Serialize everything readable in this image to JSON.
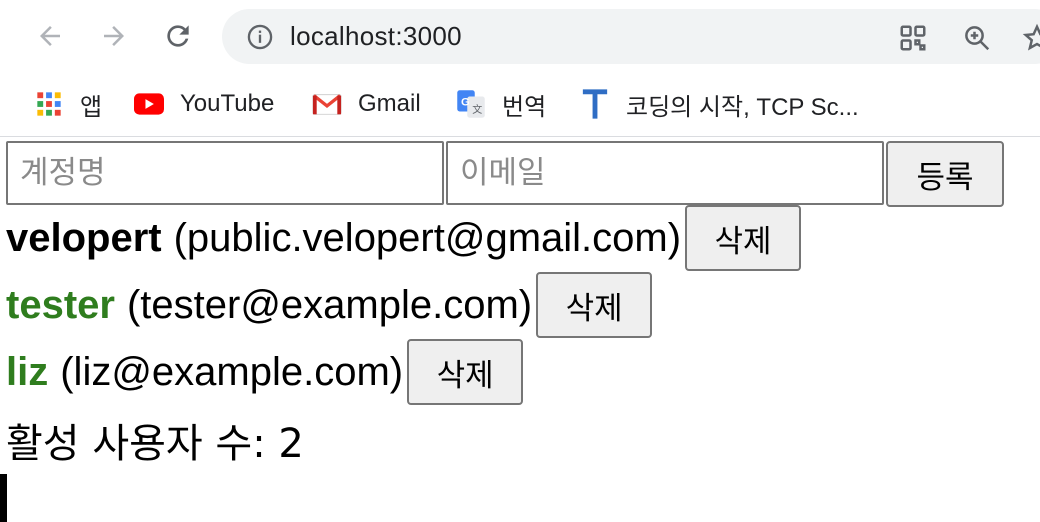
{
  "browser": {
    "url": "localhost:3000",
    "bookmarks": [
      {
        "label": "앱",
        "icon": "apps-grid-icon"
      },
      {
        "label": "YouTube",
        "icon": "youtube-icon"
      },
      {
        "label": "Gmail",
        "icon": "gmail-icon"
      },
      {
        "label": "번역",
        "icon": "google-translate-icon"
      },
      {
        "label": "코딩의 시작, TCP Sc...",
        "icon": "tcp-school-icon"
      }
    ]
  },
  "form": {
    "username_placeholder": "계정명",
    "email_placeholder": "이메일",
    "username_value": "",
    "email_value": "",
    "submit_label": "등록"
  },
  "users": [
    {
      "name": "velopert",
      "email": "(public.velopert@gmail.com)",
      "active": true,
      "color": "#000000"
    },
    {
      "name": "tester",
      "email": "(tester@example.com)",
      "active": false,
      "color": "#2f7d1e"
    },
    {
      "name": "liz",
      "email": "(liz@example.com)",
      "active": false,
      "color": "#2f7d1e"
    }
  ],
  "delete_label": "삭제",
  "active_count_text": "활성 사용자 수: 2"
}
